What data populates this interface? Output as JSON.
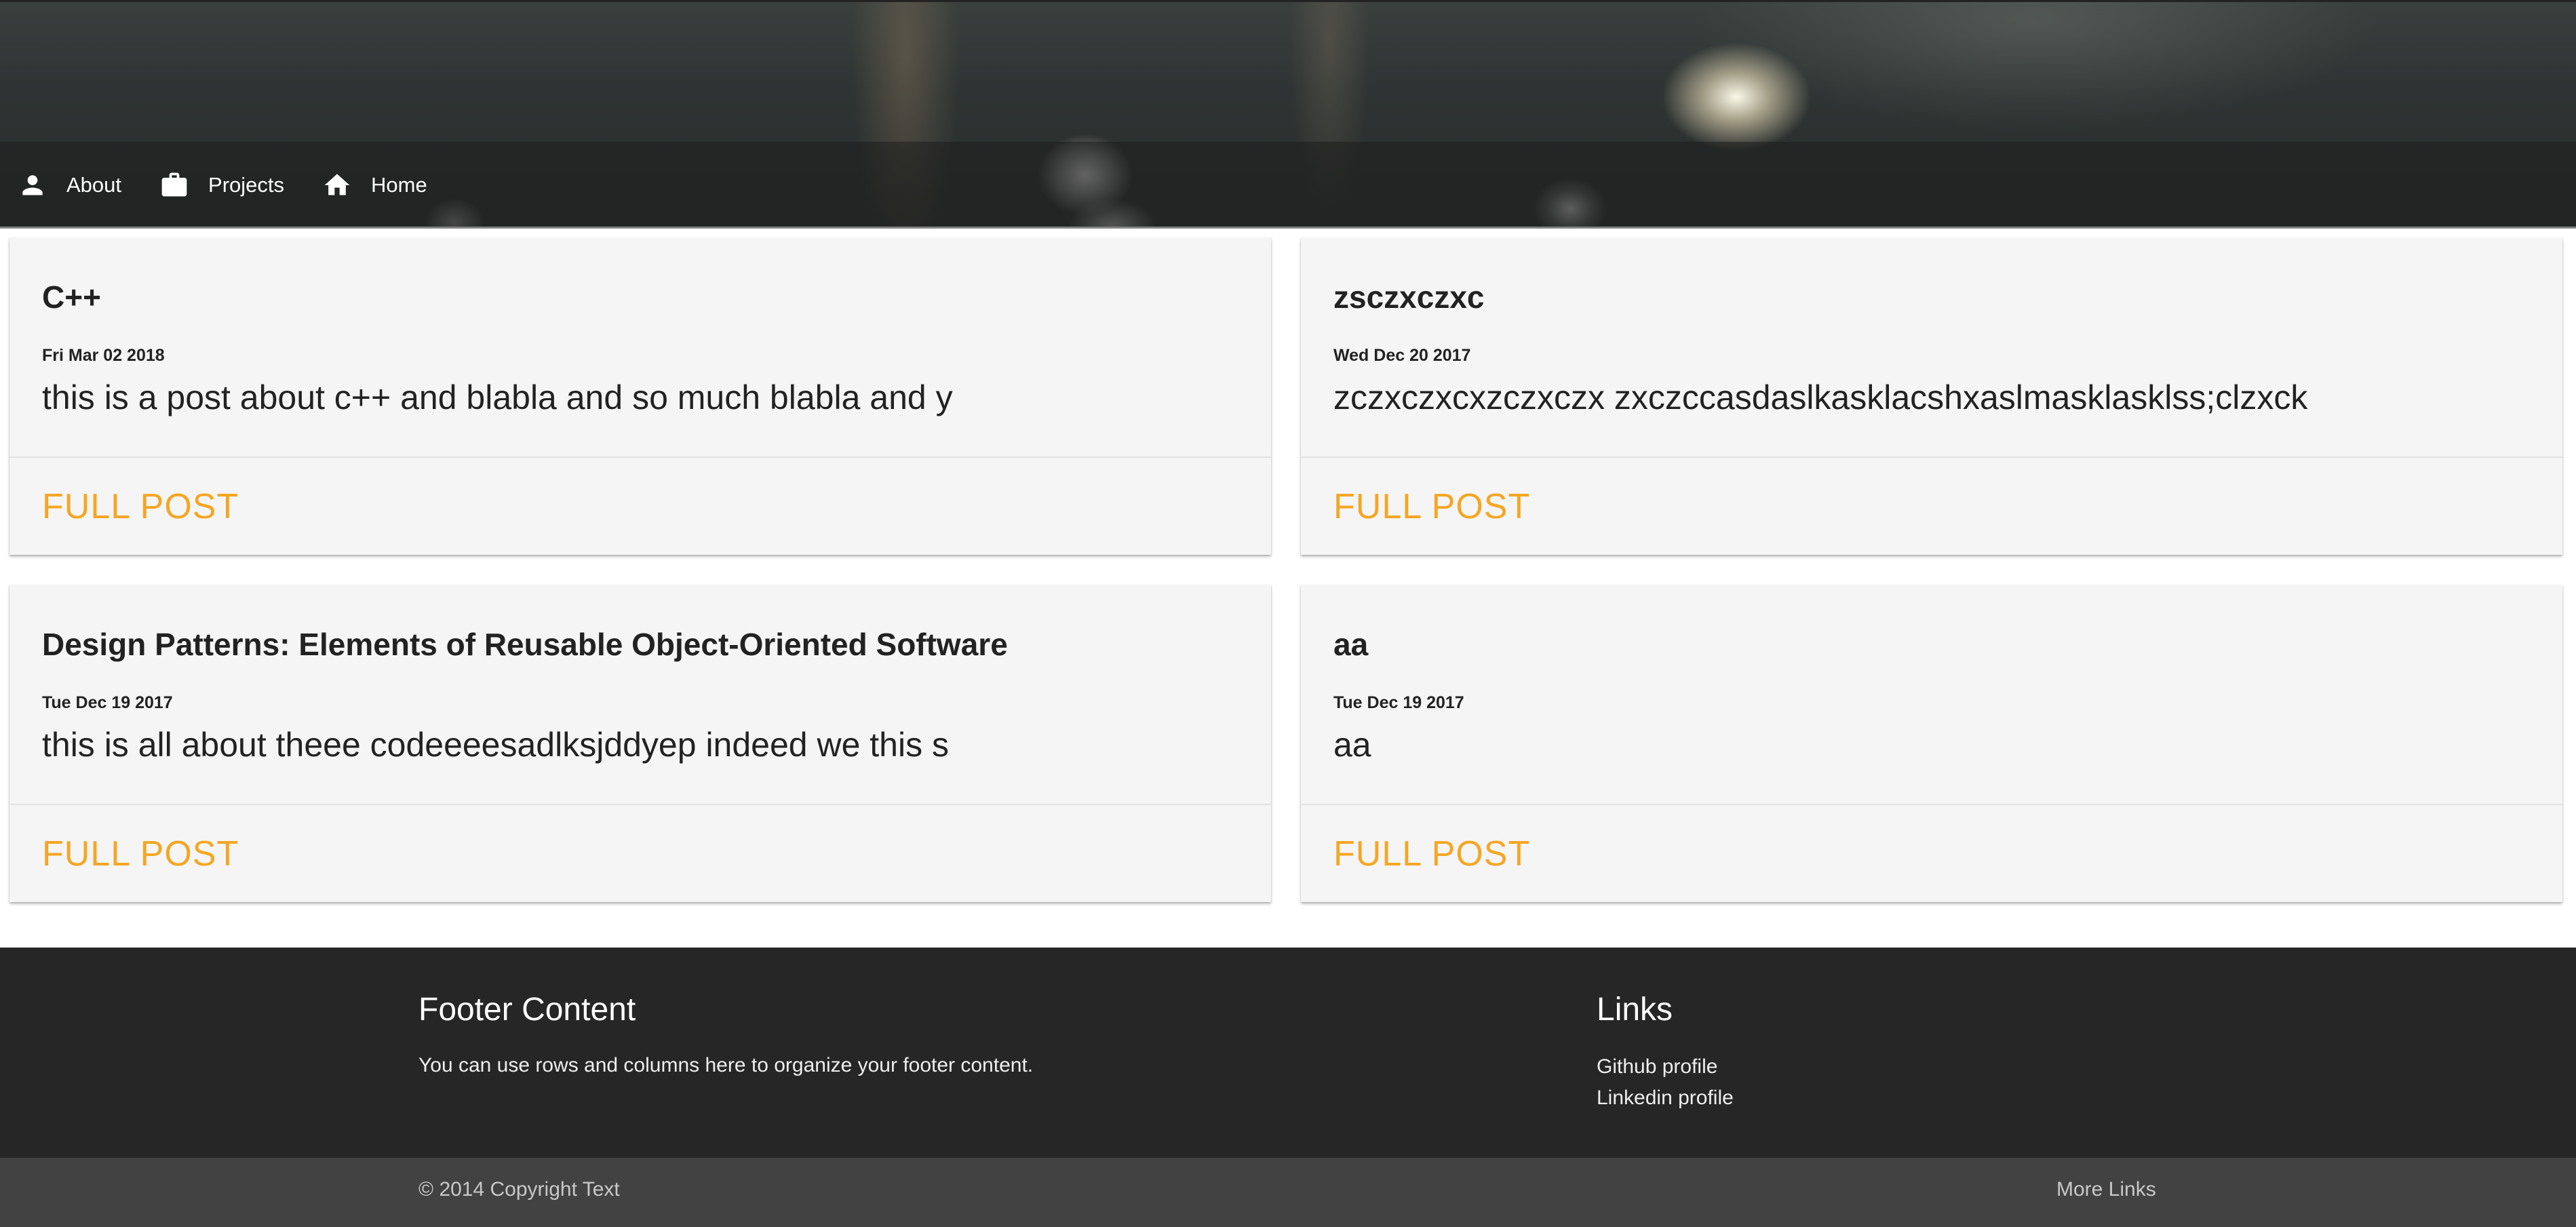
{
  "nav": {
    "items": [
      {
        "label": "About",
        "icon": "person-icon"
      },
      {
        "label": "Projects",
        "icon": "briefcase-icon"
      },
      {
        "label": "Home",
        "icon": "home-icon"
      }
    ]
  },
  "posts": [
    {
      "title": "C++",
      "date": "Fri Mar 02 2018",
      "excerpt": "this is a post about c++ and blabla and so much blabla and y",
      "action": "FULL POST"
    },
    {
      "title": "zsczxczxc",
      "date": "Wed Dec 20 2017",
      "excerpt": "zczxczxcxzczxczx zxczccasdaslkasklacshxaslmasklasklss;clzxck",
      "action": "FULL POST"
    },
    {
      "title": "Design Patterns: Elements of Reusable Object-Oriented Software",
      "date": "Tue Dec 19 2017",
      "excerpt": "this is all about theee codeeeesadlksjddyep indeed we this s",
      "action": "FULL POST"
    },
    {
      "title": "aa",
      "date": "Tue Dec 19 2017",
      "excerpt": "aa",
      "action": "FULL POST"
    }
  ],
  "footer": {
    "content_title": "Footer Content",
    "content_text": "You can use rows and columns here to organize your footer content.",
    "links_title": "Links",
    "links": [
      "Github profile",
      "Linkedin profile"
    ],
    "copyright": "© 2014 Copyright Text",
    "more_links": "More Links"
  },
  "colors": {
    "accent": "#f5a623",
    "footer_bg": "#262626",
    "copyright_bg": "#424242",
    "card_bg": "#f5f5f5"
  }
}
